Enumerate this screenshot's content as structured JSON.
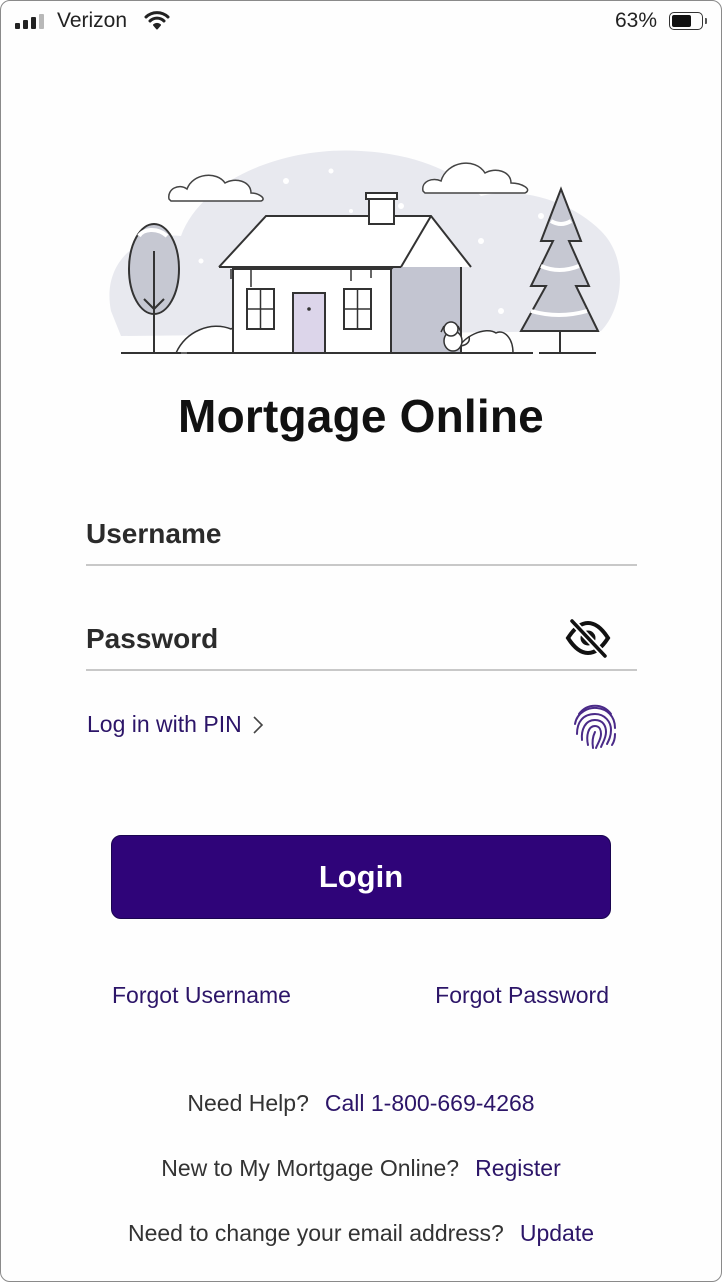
{
  "status_bar": {
    "carrier": "Verizon",
    "battery_percent": "63%",
    "signal_bars_active": 3,
    "signal_bars_total": 4,
    "battery_level": 0.63,
    "icons": [
      "signal-icon",
      "wifi-icon",
      "battery-icon"
    ]
  },
  "app": {
    "title": "Mortgage Online",
    "illustration": "snowy-house-illustration",
    "accent_color": "#2f0479",
    "link_color": "#2c1568"
  },
  "form": {
    "username_placeholder": "Username",
    "username_value": "",
    "password_placeholder": "Password",
    "password_value": "",
    "password_toggle_icon": "eye-slash-icon",
    "pin_link": "Log in with PIN",
    "pin_chevron_icon": "chevron-right-icon",
    "biometric_icon": "fingerprint-icon",
    "login_button": "Login"
  },
  "links": {
    "forgot_username": "Forgot Username",
    "forgot_password": "Forgot Password"
  },
  "help": {
    "need_help_text": "Need Help?",
    "call_link": "Call 1-800-669-4268",
    "new_user_text": "New to My Mortgage Online?",
    "register_link": "Register",
    "change_email_text": "Need to change your email address?",
    "update_link": "Update"
  }
}
